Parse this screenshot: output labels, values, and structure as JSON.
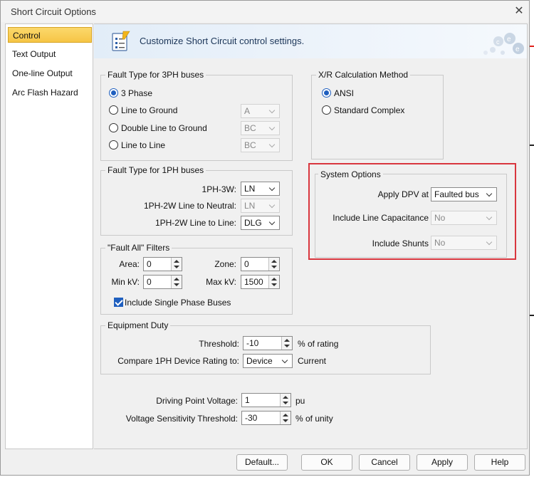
{
  "window": {
    "title": "Short Circuit Options"
  },
  "sidebar": {
    "items": [
      {
        "label": "Control",
        "active": true
      },
      {
        "label": "Text Output"
      },
      {
        "label": "One-line Output"
      },
      {
        "label": "Arc Flash Hazard"
      }
    ]
  },
  "banner": {
    "text": "Customize Short Circuit control settings.",
    "icon": "settings-document-icon",
    "logo": "ece-logo-icon"
  },
  "fault_3ph": {
    "title": "Fault Type for 3PH buses",
    "options": [
      {
        "label": "3 Phase",
        "selected": true
      },
      {
        "label": "Line to Ground",
        "combo": "A"
      },
      {
        "label": "Double Line to Ground",
        "combo": "BC"
      },
      {
        "label": "Line to Line",
        "combo": "BC"
      }
    ]
  },
  "fault_1ph": {
    "title": "Fault Type for 1PH buses",
    "rows": [
      {
        "label": "1PH-3W:",
        "value": "LN",
        "enabled": true
      },
      {
        "label": "1PH-2W Line to Neutral:",
        "value": "LN",
        "enabled": false
      },
      {
        "label": "1PH-2W Line to Line:",
        "value": "DLG",
        "enabled": true
      }
    ]
  },
  "fault_all": {
    "title": "\"Fault All\" Filters",
    "area_label": "Area:",
    "area_value": "0",
    "zone_label": "Zone:",
    "zone_value": "0",
    "minkv_label": "Min kV:",
    "minkv_value": "0",
    "maxkv_label": "Max kV:",
    "maxkv_value": "1500",
    "include_label": "Include Single Phase Buses",
    "include_checked": true
  },
  "xr": {
    "title": "X/R Calculation Method",
    "options": [
      {
        "label": "ANSI",
        "selected": true
      },
      {
        "label": "Standard Complex"
      }
    ]
  },
  "system": {
    "title": "System Options",
    "apply_dpv_label": "Apply DPV at",
    "apply_dpv_value": "Faulted bus",
    "line_cap_label": "Include Line Capacitance",
    "line_cap_value": "No",
    "shunts_label": "Include Shunts",
    "shunts_value": "No"
  },
  "equipment": {
    "title": "Equipment Duty",
    "threshold_label": "Threshold:",
    "threshold_value": "-10",
    "threshold_unit": "% of rating",
    "compare_label": "Compare 1PH Device Rating to:",
    "compare_value": "Device",
    "compare_unit": "Current"
  },
  "voltage": {
    "dpv_label": "Driving Point Voltage:",
    "dpv_value": "1",
    "dpv_unit": "pu",
    "vst_label": "Voltage Sensitivity Threshold:",
    "vst_value": "-30",
    "vst_unit": "% of unity"
  },
  "buttons": {
    "default": "Default...",
    "ok": "OK",
    "cancel": "Cancel",
    "apply": "Apply",
    "help": "Help"
  },
  "colors": {
    "accent": "#1f5fbf",
    "highlight": "#d9363e",
    "active_tab": "#f6c545"
  }
}
